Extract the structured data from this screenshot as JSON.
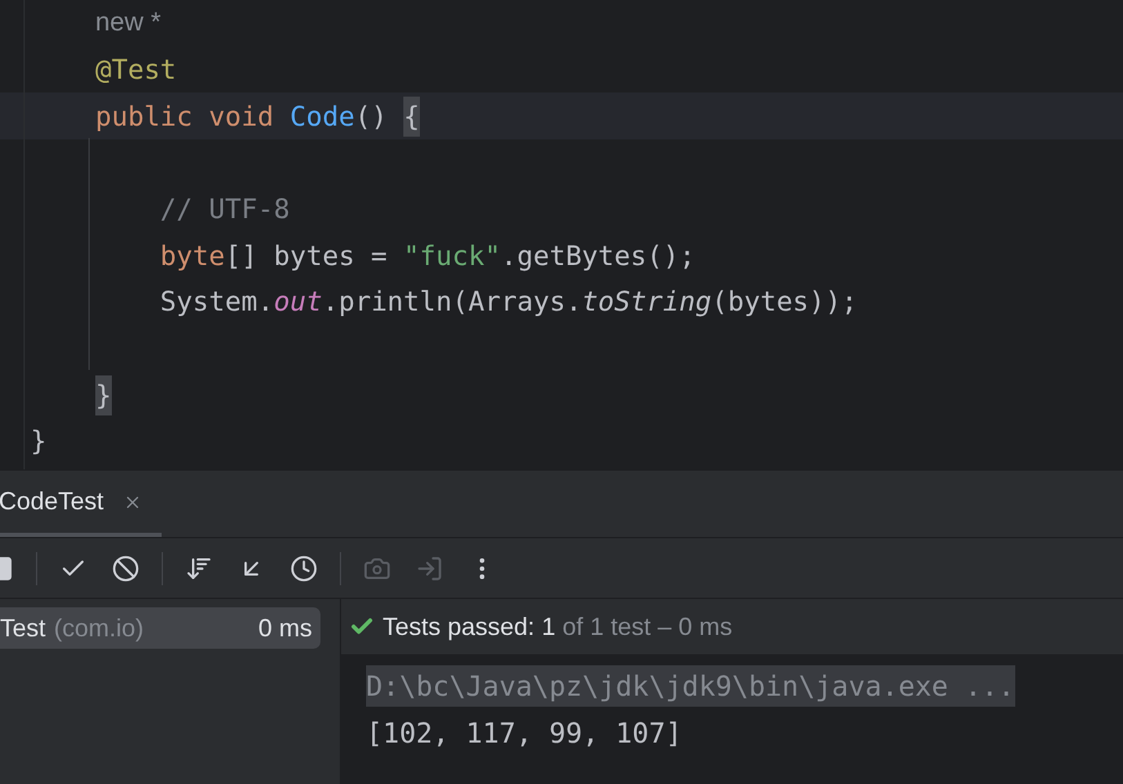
{
  "editor": {
    "lines": [
      {
        "current": false,
        "tokens": [
          {
            "text": "    new *",
            "kind": "hint"
          }
        ]
      },
      {
        "current": false,
        "tokens": [
          {
            "text": "    @Test",
            "kind": "annotation"
          }
        ]
      },
      {
        "current": true,
        "tokens": [
          {
            "text": "    public void ",
            "kind": "keyword"
          },
          {
            "text": "Code",
            "kind": "function"
          },
          {
            "text": "() ",
            "kind": "plain"
          },
          {
            "text": "{",
            "kind": "brace",
            "matched": true
          }
        ]
      },
      {
        "current": false
      },
      {
        "current": false,
        "tokens": [
          {
            "text": "        // UTF-8",
            "kind": "comment"
          }
        ]
      },
      {
        "current": false,
        "tokens": [
          {
            "text": "        byte",
            "kind": "keyword"
          },
          {
            "text": "[] bytes = ",
            "kind": "plain"
          },
          {
            "text": "\"fuck\"",
            "kind": "string"
          },
          {
            "text": ".getBytes();",
            "kind": "plain"
          }
        ]
      },
      {
        "current": false,
        "tokens": [
          {
            "text": "        System.",
            "kind": "plain"
          },
          {
            "text": "out",
            "kind": "field"
          },
          {
            "text": ".println(Arrays.",
            "kind": "plain"
          },
          {
            "text": "toString",
            "kind": "static"
          },
          {
            "text": "(bytes));",
            "kind": "plain"
          }
        ]
      },
      {
        "current": false
      },
      {
        "current": false,
        "tokens": [
          {
            "text": "    }",
            "kind": "brace",
            "matched": true
          }
        ]
      },
      {
        "current": false,
        "tokens": [
          {
            "text": "}",
            "kind": "brace",
            "matched": false
          }
        ]
      }
    ]
  },
  "run_panel": {
    "tabs": [
      {
        "label": "CodeTest",
        "selected": true
      }
    ],
    "toolbar": [
      {
        "disabled": false
      },
      {
        "disabled": false
      },
      {
        "disabled": false
      },
      {
        "disabled": false
      },
      {
        "disabled": false
      },
      {
        "disabled": false
      },
      {
        "disabled": true
      },
      {
        "disabled": true
      },
      {
        "disabled": false
      }
    ],
    "tree": [
      {
        "name": "Test",
        "package": "(com.io)",
        "time": "0 ms",
        "selected": true
      }
    ],
    "status": {
      "passed": true,
      "label": "Tests passed:",
      "count": "1",
      "detail": "of 1 test – 0 ms"
    },
    "console": [
      {
        "kind": "command",
        "text": "D:\\bc\\Java\\pz\\jdk\\jdk9\\bin\\java.exe ..."
      },
      {
        "kind": "output",
        "text": "[102, 117, 99, 107]"
      }
    ]
  }
}
